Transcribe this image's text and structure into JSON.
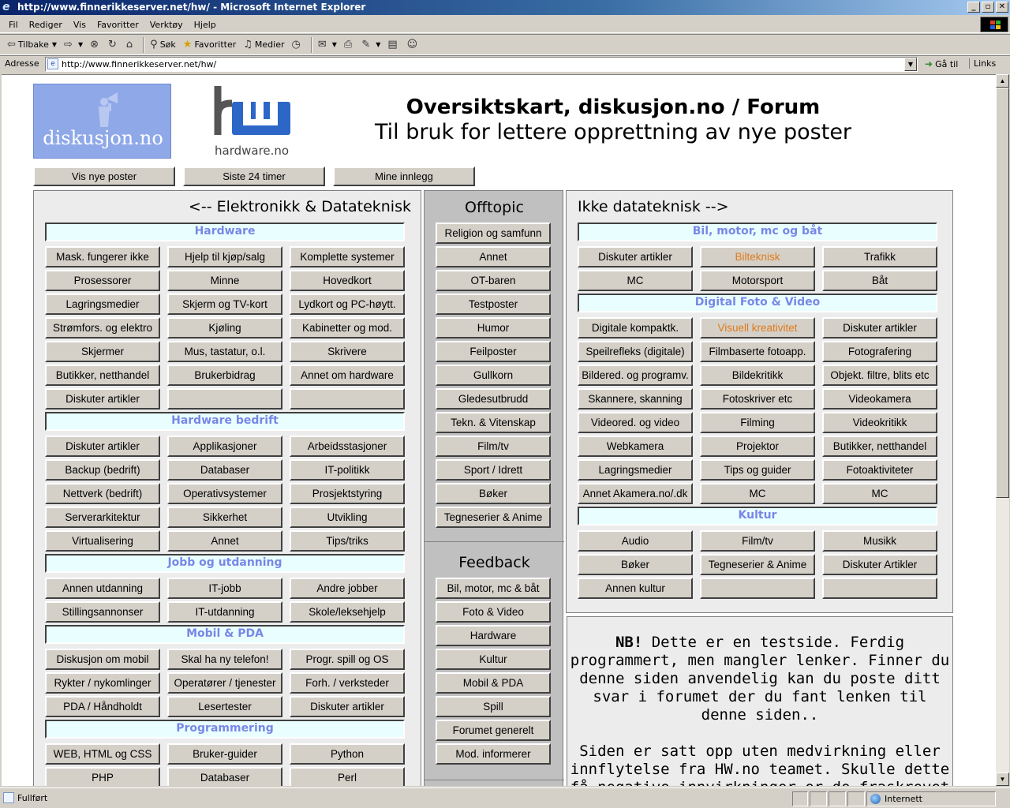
{
  "window": {
    "title": "http://www.finnerikkeserver.net/hw/ - Microsoft Internet Explorer"
  },
  "menu": [
    "Fil",
    "Rediger",
    "Vis",
    "Favoritter",
    "Verktøy",
    "Hjelp"
  ],
  "toolbar": {
    "back": "Tilbake",
    "search": "Søk",
    "favorites": "Favoritter",
    "media": "Medier"
  },
  "address": {
    "label": "Adresse",
    "url": "http://www.finnerikkeserver.net/hw/",
    "go": "Gå til",
    "links": "Links"
  },
  "status": {
    "text": "Fullført",
    "zone": "Internett"
  },
  "page": {
    "logo1_text": "diskusjon.no",
    "logo2_text": "hardware.no",
    "title": "Oversiktskart, diskusjon.no / Forum",
    "subtitle": "Til bruk for lettere opprettning av nye poster",
    "nav": [
      "Vis nye poster",
      "Siste 24 timer",
      "Mine innlegg"
    ]
  },
  "left": {
    "heading": "<-- Elektronikk & Datateknisk",
    "sections": [
      {
        "title": "Hardware",
        "buttons": [
          "Mask. fungerer ikke",
          "Hjelp til kjøp/salg",
          "Komplette systemer",
          "Prosessorer",
          "Minne",
          "Hovedkort",
          "Lagringsmedier",
          "Skjerm og TV-kort",
          "Lydkort og PC-høytt.",
          "Strømfors. og elektro",
          "Kjøling",
          "Kabinetter og mod.",
          "Skjermer",
          "Mus, tastatur, o.l.",
          "Skrivere",
          "Butikker, netthandel",
          "Brukerbidrag",
          "Annet om hardware",
          "Diskuter artikler",
          "",
          ""
        ]
      },
      {
        "title": "Hardware bedrift",
        "buttons": [
          "Diskuter artikler",
          "Applikasjoner",
          "Arbeidsstasjoner",
          "Backup (bedrift)",
          "Databaser",
          "IT-politikk",
          "Nettverk (bedrift)",
          "Operativsystemer",
          "Prosjektstyring",
          "Serverarkitektur",
          "Sikkerhet",
          "Utvikling",
          "Virtualisering",
          "Annet",
          "Tips/triks"
        ]
      },
      {
        "title": "Jobb og utdanning",
        "buttons": [
          "Annen utdanning",
          "IT-jobb",
          "Andre jobber",
          "Stillingsannonser",
          "IT-utdanning",
          "Skole/leksehjelp"
        ]
      },
      {
        "title": "Mobil & PDA",
        "buttons": [
          "Diskusjon om mobil",
          "Skal ha ny telefon!",
          "Progr. spill og OS",
          "Rykter / nykomlinger",
          "Operatører / tjenester",
          "Forh. / verksteder",
          "PDA / Håndholdt",
          "Lesertester",
          "Diskuter artikler"
        ]
      },
      {
        "title": "Programmering",
        "buttons": [
          "WEB, HTML og CSS",
          "Bruker-guider",
          "Python",
          "PHP",
          "Databaser",
          "Perl"
        ]
      }
    ]
  },
  "middle": {
    "heading1": "Offtopic",
    "offtopic": [
      "Religion og samfunn",
      "Annet",
      "OT-baren",
      "Testposter",
      "Humor",
      "Feilposter",
      "Gullkorn",
      "Gledesutbrudd",
      "Tekn. & Vitenskap",
      "Film/tv",
      "Sport / Idrett",
      "Bøker",
      "Tegneserier & Anime"
    ],
    "heading2": "Feedback",
    "feedback": [
      "Bil, motor, mc & båt",
      "Foto & Video",
      "Hardware",
      "Kultur",
      "Mobil & PDA",
      "Spill",
      "Forumet generelt",
      "Mod. informerer"
    ]
  },
  "right": {
    "heading": "Ikke datateknisk -->",
    "sections": [
      {
        "title": "Bil, motor, mc og båt",
        "buttons": [
          "Diskuter artikler",
          "Bilteknisk",
          "Trafikk",
          "MC",
          "Motorsport",
          "Båt"
        ]
      },
      {
        "title": "Digital Foto & Video",
        "buttons": [
          "Digitale kompaktk.",
          "Visuell kreativitet",
          "Diskuter artikler",
          "Speilrefleks (digitale)",
          "Filmbaserte fotoapp.",
          "Fotografering",
          "Bildered. og programv.",
          "Bildekritikk",
          "Objekt. filtre, blits etc",
          "Skannere, skanning",
          "Fotoskriver etc",
          "Videokamera",
          "Videored. og video",
          "Filming",
          "Videokritikk",
          "Webkamera",
          "Projektor",
          "Butikker, netthandel",
          "Lagringsmedier",
          "Tips og guider",
          "Fotoaktiviteter",
          "Annet Akamera.no/.dk",
          "MC",
          "MC"
        ]
      },
      {
        "title": "Kultur",
        "buttons": [
          "Audio",
          "Film/tv",
          "Musikk",
          "Bøker",
          "Tegneserier & Anime",
          "Diskuter Artikler",
          "Annen kultur",
          "",
          ""
        ]
      }
    ],
    "orange_buttons": [
      "Bilteknisk",
      "Visuell kreativitet"
    ]
  },
  "notice": {
    "nb": "NB!",
    "p1": "Dette er en testside. Ferdig programmert, men mangler lenker. Finner du denne siden anvendelig kan du poste ditt svar i forumet der du fant lenken til denne siden..",
    "p2": "Siden er satt opp uten medvirkning eller innflytelse fra HW.no teamet. Skulle dette få negative innvirkninger er de fraskrevet alt ansvar."
  },
  "colors": {
    "section_title": "#7887e6",
    "section_bg": "#e9ffff",
    "accent_orange": "#e07a1a",
    "titlebar": "#0a246a"
  }
}
